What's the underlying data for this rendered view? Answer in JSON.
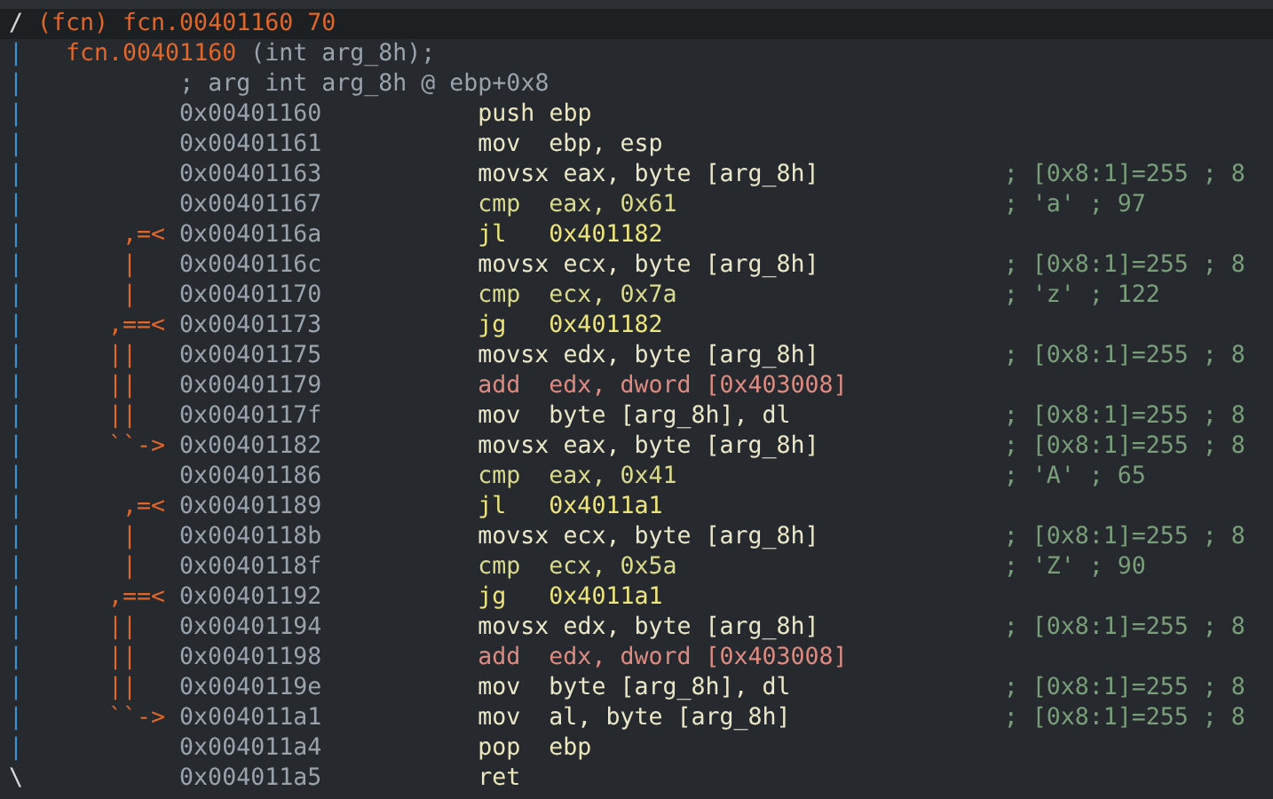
{
  "header": {
    "marker": "/",
    "title": "(fcn) fcn.00401160",
    "size": "70",
    "highlighted": true
  },
  "signature": {
    "gutter": "|",
    "name": "fcn.00401160",
    "params": "(int arg_8h);"
  },
  "arg_note": {
    "gutter": "|",
    "text": "; arg int arg_8h @ ebp+0x8"
  },
  "instructions": [
    {
      "gutter": "|",
      "address": "0x00401160",
      "kind": "stack",
      "mnemonic": "push",
      "operands": "ebp"
    },
    {
      "gutter": "|",
      "address": "0x00401161",
      "kind": "mov",
      "mnemonic": "mov",
      "operands": "ebp, esp"
    },
    {
      "gutter": "|",
      "address": "0x00401163",
      "kind": "mov",
      "mnemonic": "movsx",
      "operands": "eax, byte [arg_8h]",
      "comment": "; [0x8:1]=255 ; 8"
    },
    {
      "gutter": "|",
      "address": "0x00401167",
      "kind": "cmp",
      "mnemonic": "cmp",
      "operands": "eax, 0x61",
      "comment": "; 'a' ; 97"
    },
    {
      "gutter": "|",
      "arrow": " ,=<",
      "address": "0x0040116a",
      "kind": "jmp",
      "mnemonic": "jl",
      "operands": "0x401182"
    },
    {
      "gutter": "|",
      "arrow": " |",
      "address": "0x0040116c",
      "kind": "mov",
      "mnemonic": "movsx",
      "operands": "ecx, byte [arg_8h]",
      "comment": "; [0x8:1]=255 ; 8"
    },
    {
      "gutter": "|",
      "arrow": " |",
      "address": "0x00401170",
      "kind": "cmp",
      "mnemonic": "cmp",
      "operands": "ecx, 0x7a",
      "comment": "; 'z' ; 122"
    },
    {
      "gutter": "|",
      "arrow": ",==<",
      "address": "0x00401173",
      "kind": "jmp",
      "mnemonic": "jg",
      "operands": "0x401182"
    },
    {
      "gutter": "|",
      "arrow": "||",
      "address": "0x00401175",
      "kind": "mov",
      "mnemonic": "movsx",
      "operands": "edx, byte [arg_8h]",
      "comment": "; [0x8:1]=255 ; 8"
    },
    {
      "gutter": "|",
      "arrow": "||",
      "address": "0x00401179",
      "kind": "add",
      "mnemonic": "add",
      "operands": "edx, dword [0x403008]"
    },
    {
      "gutter": "|",
      "arrow": "||",
      "address": "0x0040117f",
      "kind": "mov",
      "mnemonic": "mov",
      "operands": "byte [arg_8h], dl",
      "comment": "; [0x8:1]=255 ; 8"
    },
    {
      "gutter": "|",
      "arrow": "``->",
      "address": "0x00401182",
      "kind": "mov",
      "mnemonic": "movsx",
      "operands": "eax, byte [arg_8h]",
      "comment": "; [0x8:1]=255 ; 8"
    },
    {
      "gutter": "|",
      "address": "0x00401186",
      "kind": "cmp",
      "mnemonic": "cmp",
      "operands": "eax, 0x41",
      "comment": "; 'A' ; 65"
    },
    {
      "gutter": "|",
      "arrow": " ,=<",
      "address": "0x00401189",
      "kind": "jmp",
      "mnemonic": "jl",
      "operands": "0x4011a1"
    },
    {
      "gutter": "|",
      "arrow": " |",
      "address": "0x0040118b",
      "kind": "mov",
      "mnemonic": "movsx",
      "operands": "ecx, byte [arg_8h]",
      "comment": "; [0x8:1]=255 ; 8"
    },
    {
      "gutter": "|",
      "arrow": " |",
      "address": "0x0040118f",
      "kind": "cmp",
      "mnemonic": "cmp",
      "operands": "ecx, 0x5a",
      "comment": "; 'Z' ; 90"
    },
    {
      "gutter": "|",
      "arrow": ",==<",
      "address": "0x00401192",
      "kind": "jmp",
      "mnemonic": "jg",
      "operands": "0x4011a1"
    },
    {
      "gutter": "|",
      "arrow": "||",
      "address": "0x00401194",
      "kind": "mov",
      "mnemonic": "movsx",
      "operands": "edx, byte [arg_8h]",
      "comment": "; [0x8:1]=255 ; 8"
    },
    {
      "gutter": "|",
      "arrow": "||",
      "address": "0x00401198",
      "kind": "add",
      "mnemonic": "add",
      "operands": "edx, dword [0x403008]"
    },
    {
      "gutter": "|",
      "arrow": "||",
      "address": "0x0040119e",
      "kind": "mov",
      "mnemonic": "mov",
      "operands": "byte [arg_8h], dl",
      "comment": "; [0x8:1]=255 ; 8"
    },
    {
      "gutter": "|",
      "arrow": "``->",
      "address": "0x004011a1",
      "kind": "mov",
      "mnemonic": "mov",
      "operands": "al, byte [arg_8h]",
      "comment": "; [0x8:1]=255 ; 8"
    },
    {
      "gutter": "|",
      "address": "0x004011a4",
      "kind": "stack",
      "mnemonic": "pop",
      "operands": "ebp"
    },
    {
      "gutter": "\\",
      "address": "0x004011a5",
      "kind": "ret",
      "mnemonic": "ret"
    }
  ]
}
